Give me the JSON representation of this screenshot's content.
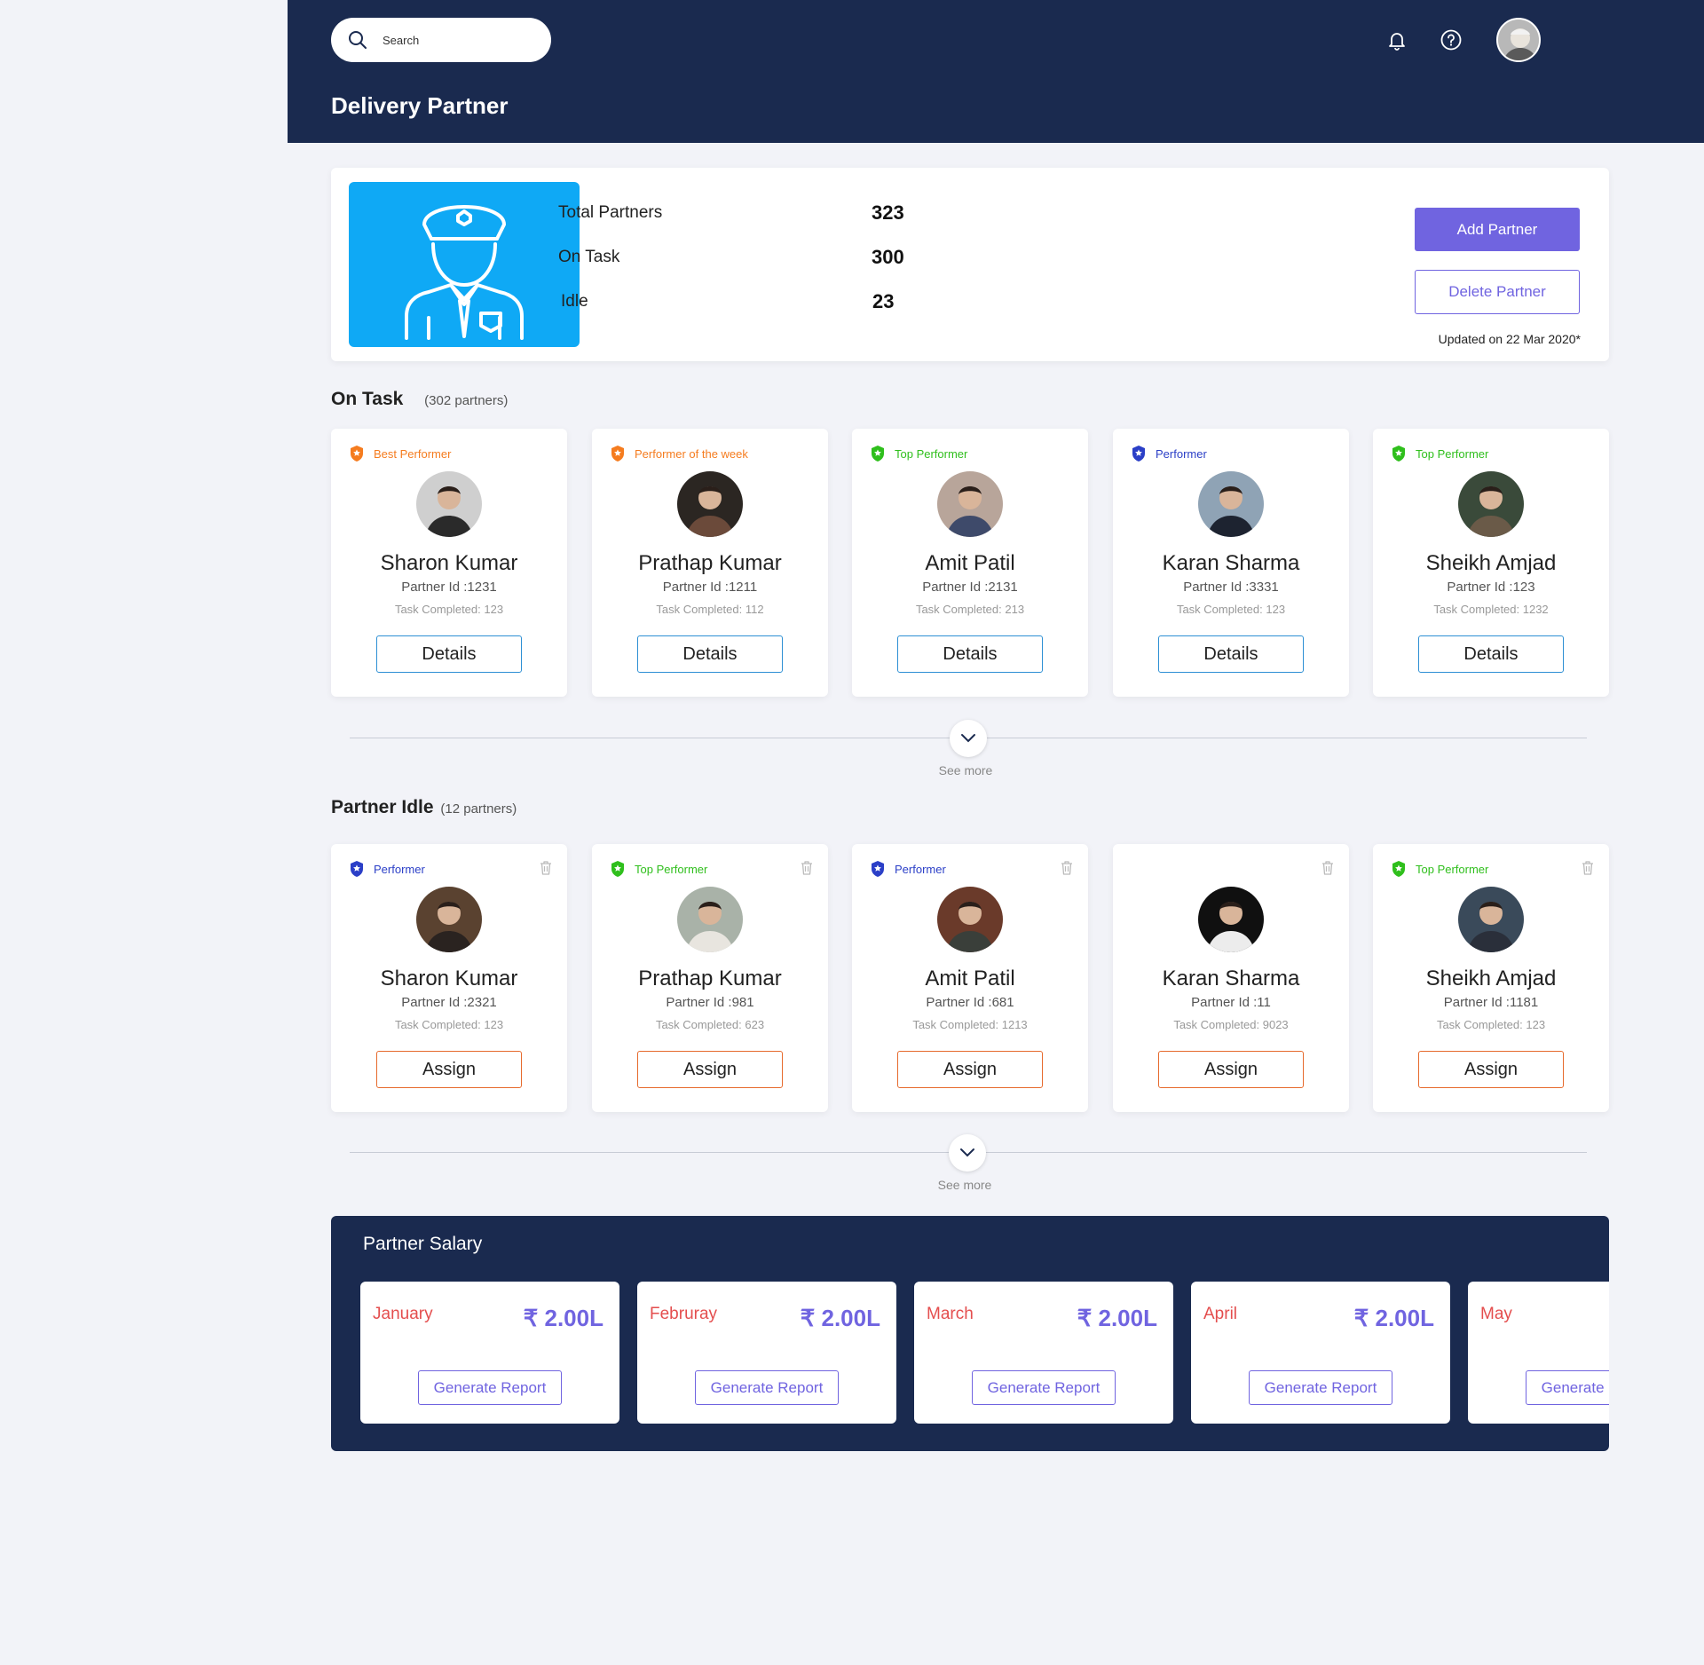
{
  "header": {
    "search_placeholder": "Search",
    "page_title": "Delivery Partner"
  },
  "summary": {
    "stats": [
      {
        "label": "Total Partners",
        "value": "323"
      },
      {
        "label": "On Task",
        "value": "300"
      },
      {
        "label": "Idle",
        "value": "23"
      }
    ],
    "add_label": "Add Partner",
    "delete_label": "Delete Partner",
    "updated": "Updated on 22 Mar 2020*"
  },
  "on_task": {
    "title": "On Task",
    "count": "(302 partners)",
    "cards": [
      {
        "badge": "Best Performer",
        "badge_color": "#f57c1f",
        "name": "Sharon Kumar",
        "pid": "Partner Id :1231",
        "task": "Task Completed: 123",
        "button": "Details"
      },
      {
        "badge": "Performer of the week",
        "badge_color": "#f57c1f",
        "name": "Prathap Kumar",
        "pid": "Partner Id :1211",
        "task": "Task Completed: 112",
        "button": "Details"
      },
      {
        "badge": "Top Performer",
        "badge_color": "#2fbf1c",
        "name": "Amit Patil",
        "pid": "Partner Id :2131",
        "task": "Task Completed: 213",
        "button": "Details"
      },
      {
        "badge": "Performer",
        "badge_color": "#2b3fc7",
        "name": "Karan Sharma",
        "pid": "Partner Id :3331",
        "task": "Task Completed: 123",
        "button": "Details"
      },
      {
        "badge": "Top Performer",
        "badge_color": "#2fbf1c",
        "name": "Sheikh Amjad",
        "pid": "Partner Id :123",
        "task": "Task Completed: 1232",
        "button": "Details"
      }
    ],
    "see_more": "See more"
  },
  "idle": {
    "title": "Partner Idle",
    "count": "(12 partners)",
    "cards": [
      {
        "badge": "Performer",
        "badge_color": "#2b3fc7",
        "name": "Sharon Kumar",
        "pid": "Partner Id :2321",
        "task": "Task Completed: 123",
        "button": "Assign"
      },
      {
        "badge": "Top Performer",
        "badge_color": "#2fbf1c",
        "name": "Prathap Kumar",
        "pid": "Partner Id :981",
        "task": "Task Completed: 623",
        "button": "Assign"
      },
      {
        "badge": "Performer",
        "badge_color": "#2b3fc7",
        "name": "Amit Patil",
        "pid": "Partner Id :681",
        "task": "Task Completed: 1213",
        "button": "Assign"
      },
      {
        "badge": "",
        "badge_color": "",
        "name": "Karan Sharma",
        "pid": "Partner Id :11",
        "task": "Task Completed: 9023",
        "button": "Assign"
      },
      {
        "badge": "Top Performer",
        "badge_color": "#2fbf1c",
        "name": "Sheikh Amjad",
        "pid": "Partner Id :1181",
        "task": "Task Completed: 123",
        "button": "Assign"
      }
    ],
    "see_more": "See more"
  },
  "salary": {
    "title": "Partner Salary",
    "months": [
      {
        "month": "January",
        "amount": "₹ 2.00L",
        "button": "Generate Report"
      },
      {
        "month": "Februray",
        "amount": "₹ 2.00L",
        "button": "Generate Report"
      },
      {
        "month": "March",
        "amount": "₹ 2.00L",
        "button": "Generate Report"
      },
      {
        "month": "April",
        "amount": "₹ 2.00L",
        "button": "Generate Report"
      },
      {
        "month": "May",
        "amount": "",
        "button": "Generate Report"
      }
    ]
  },
  "colors": {
    "navy": "#1a2a4f",
    "accent_purple": "#7064e0",
    "hero_blue": "#0fa9f5",
    "details_border": "#2d8fd4",
    "assign_border": "#e66a2c",
    "month_red": "#e44e4e"
  }
}
